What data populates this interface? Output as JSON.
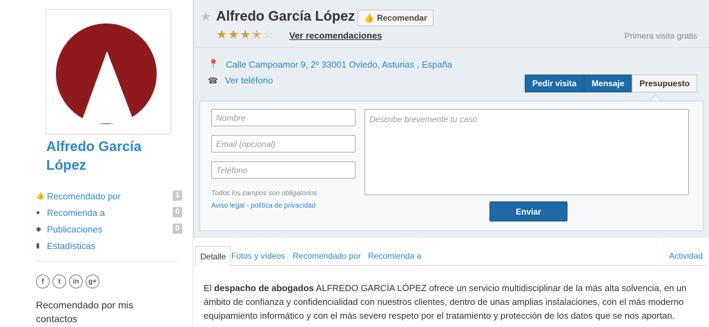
{
  "profile": {
    "name": "Alfredo García López"
  },
  "sidebar": {
    "items": [
      {
        "label": "Recomendado por",
        "icon": "thumbs-up-icon",
        "count": "1"
      },
      {
        "label": "Recomienda a",
        "icon": "user-icon",
        "count": "0"
      },
      {
        "label": "Publicaciones",
        "icon": "comment-icon",
        "count": "0"
      },
      {
        "label": "Estadísticas",
        "icon": "bar-chart-icon",
        "count": ""
      }
    ],
    "social": [
      "f",
      "t",
      "in",
      "g+"
    ],
    "contacts_label": "Recomendado por mis contactos"
  },
  "header": {
    "title": "Alfredo García López",
    "recommend_label": "Recomendar",
    "rating": 3.5,
    "rating_max": 5,
    "ver_recomendaciones": "Ver recomendaciones",
    "primera_visita": "Primera visita gratis",
    "address": "Calle Campoamor 9, 2º 33001 Oviedo, Asturias , España",
    "phone": "Ver teléfono"
  },
  "actions": {
    "pedir_visita": "Pedir visita",
    "mensaje": "Mensaje",
    "presupuesto": "Presupuesto"
  },
  "form": {
    "nombre_placeholder": "Nombre",
    "email_placeholder": "Email (opcional)",
    "telefono_placeholder": "Teléfono",
    "caso_placeholder": "Describe brevemente tu caso",
    "required_note": "Todos los campos son obligatorios",
    "legal_link": "Aviso legal - política de privacidad",
    "submit_label": "Enviar"
  },
  "tabs": [
    {
      "label": "Detalle"
    },
    {
      "label": "Fotos y vídeos"
    },
    {
      "label": "Recomendado por"
    },
    {
      "label": "Recomienda a"
    },
    {
      "label": "Actividad"
    }
  ],
  "content": {
    "intro": "El ",
    "bold": "despacho de abogados",
    "rest": " ALFREDO GARCÍA LÓPEZ  ofrece un servicio multidisciplinar de la más alta solvencia, en un ámbito de confianza y confidencialidad con nuestros clientes, dentro de unas amplias instalaciones, con el más moderno equipamiento informático y con el más severo respeto por el tratamiento y protección de los datos que se nos aportan."
  },
  "colors": {
    "accent": "#2a87c8",
    "button_blue": "#1e6aa6",
    "logo_red": "#8e1a1e",
    "star_gold": "#c9a23b"
  }
}
